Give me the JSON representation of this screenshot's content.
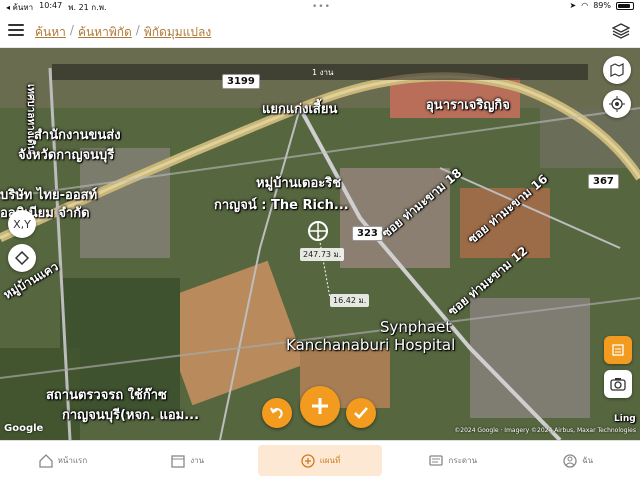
{
  "statusbar": {
    "carrier": "◂ ค้นหา",
    "time": "10:47",
    "date": "พ. 21 ก.พ.",
    "battery": "89%",
    "battery_fraction": 0.89
  },
  "header": {
    "breadcrumb": [
      "ค้นหา",
      "ค้นหาพิกัด",
      "พิกัดมุมแปลง"
    ],
    "separator": "/"
  },
  "map": {
    "scale_label": "1 งาน",
    "labels": {
      "road_left": "เทศบาลทางเดิน",
      "road_3199": "3199",
      "intersection": "แยกแก่งเสี้ยน",
      "shop": "อุนาราเจริญกิจ",
      "office_line1": "สำนักงานขนส่ง",
      "office_line2": "จังหวัดกาญจนบุรี",
      "company_line1": "บริษัท ไทย-ออสท์",
      "company_line2": "อลูมิเนียม จำกัด",
      "village_line1": "หมู่บ้านเดอะริช",
      "village_line2": "กาญจน์ : The Rich...",
      "road_323": "323",
      "road_367": "367",
      "soi18": "ซอย ท่ามะขาม 18",
      "soi16": "ซอย ท่ามะขาม 16",
      "soi12": "ซอย ท่ามะขาม 12",
      "hospital_line1": "Synphaet",
      "hospital_line2": "Kanchanaburi Hospital",
      "area_left": "หมู่บ้านแคว",
      "station_line1": "สถานตรวจรถ ใช้ก๊าซ",
      "station_line2": "กาญจนบุรี(หจก. แอม...",
      "ling": "Ling",
      "measure1": "247.73 ม.",
      "measure2": "16.42 ม."
    },
    "controls": {
      "xy": "X,Y",
      "google": "Google",
      "copyright": "©2024 Google · Imagery ©2024 Airbus, Maxar Technologies"
    },
    "accent_color": "#f39b1f"
  },
  "bottomnav": {
    "items": [
      {
        "label": "หน้าแรก",
        "icon": "home-icon"
      },
      {
        "label": "งาน",
        "icon": "calendar-icon"
      },
      {
        "label": "แผนที่",
        "icon": "plus-circle-icon",
        "active": true
      },
      {
        "label": "กระดาน",
        "icon": "chat-icon"
      },
      {
        "label": "ฉัน",
        "icon": "user-icon"
      }
    ]
  }
}
